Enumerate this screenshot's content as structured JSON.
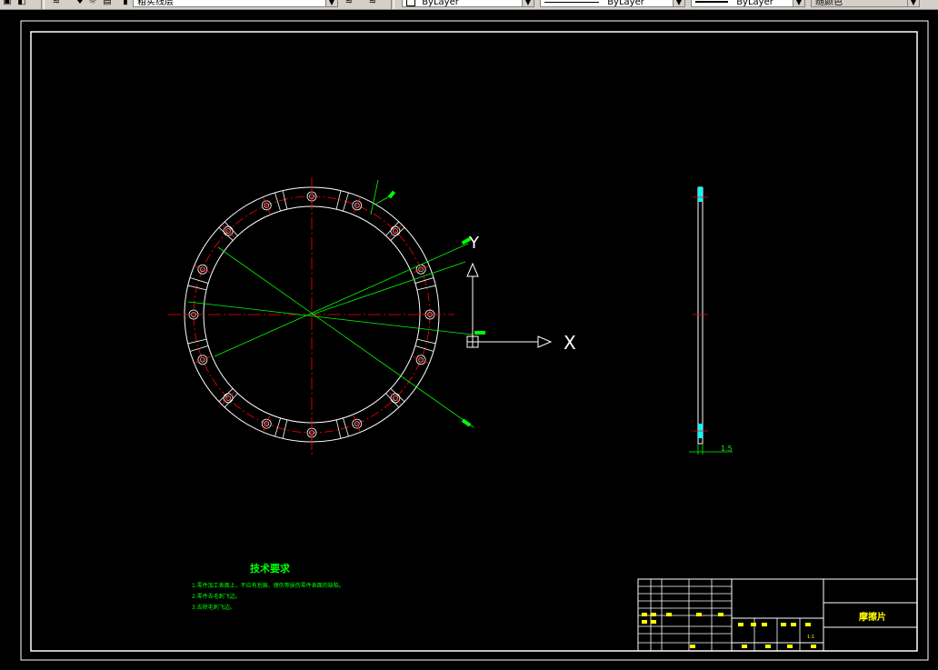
{
  "toolbar": {
    "layer_name": "粗实线层",
    "color_value": "ByLayer",
    "linetype_value": "ByLayer",
    "lineweight_value": "ByLayer",
    "plotstyle_value": "随颜色"
  },
  "drawing": {
    "dimensions": {
      "right_view_thickness": "1.5"
    },
    "axis_labels": {
      "x": "X",
      "y": "Y"
    },
    "tech_requirements": {
      "title": "技术要求",
      "items": [
        "1.零件加工表面上，不应有划痕、擦伤等损伤零件表面的缺陷。",
        "2.零件去毛刺飞边。",
        "3.去除毛刺飞边。"
      ]
    },
    "title_block": {
      "part_name": "摩擦片",
      "scale": "1:1"
    }
  },
  "colors": {
    "background": "#000000",
    "outline": "#ffffff",
    "centerline": "#ff0000",
    "dimension": "#00ff00",
    "text": "#ffff00",
    "highlight": "#00ffff"
  }
}
